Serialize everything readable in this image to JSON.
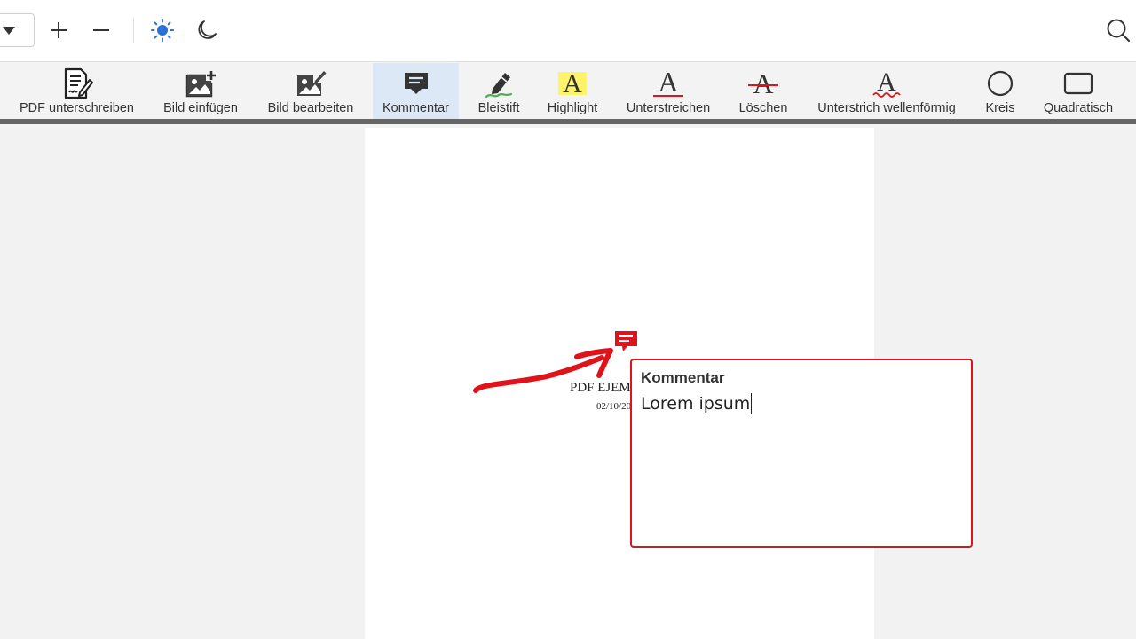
{
  "toolbar": {
    "items": [
      {
        "label": "PDF unterschreiben",
        "icon": "sign-document-icon",
        "active": false
      },
      {
        "label": "Bild einfügen",
        "icon": "insert-image-icon",
        "active": false
      },
      {
        "label": "Bild bearbeiten",
        "icon": "edit-image-icon",
        "active": false
      },
      {
        "label": "Kommentar",
        "icon": "comment-icon",
        "active": true
      },
      {
        "label": "Bleistift",
        "icon": "pencil-icon",
        "active": false
      },
      {
        "label": "Highlight",
        "icon": "highlight-icon",
        "active": false
      },
      {
        "label": "Unterstreichen",
        "icon": "underline-icon",
        "active": false
      },
      {
        "label": "Löschen",
        "icon": "strikethrough-icon",
        "active": false
      },
      {
        "label": "Unterstrich wellenförmig",
        "icon": "wavy-underline-icon",
        "active": false
      },
      {
        "label": "Kreis",
        "icon": "circle-icon",
        "active": false
      },
      {
        "label": "Quadratisch",
        "icon": "square-icon",
        "active": false
      }
    ]
  },
  "document": {
    "title": "PDF EJEMPLO",
    "date": "02/10/2019"
  },
  "comment": {
    "heading": "Kommentar",
    "text": "Lorem ipsum"
  },
  "colors": {
    "accent": "#2b6fd6",
    "annotation": "#e1131a",
    "highlight": "#fff36b",
    "pencil": "#4caf50"
  }
}
